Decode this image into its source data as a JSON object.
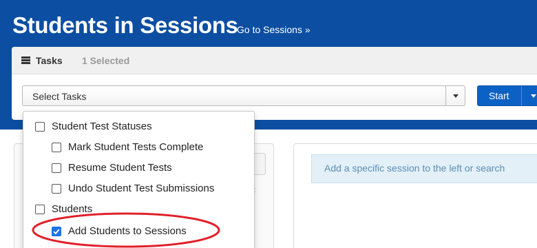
{
  "header": {
    "title": "Students in Sessions",
    "go_link": "Go to Sessions »"
  },
  "tasks": {
    "label": "Tasks",
    "selected_count": "1 Selected",
    "select_placeholder": "Select Tasks",
    "start_label": "Start",
    "menu": [
      {
        "label": "Student Test Statuses",
        "checked": false,
        "level": 0
      },
      {
        "label": "Mark Student Tests Complete",
        "checked": false,
        "level": 1
      },
      {
        "label": "Resume Student Tests",
        "checked": false,
        "level": 1
      },
      {
        "label": "Undo Student Test Submissions",
        "checked": false,
        "level": 1
      },
      {
        "label": "Students",
        "checked": false,
        "level": 0
      },
      {
        "label": "Add Students to Sessions",
        "checked": true,
        "level": 1
      }
    ]
  },
  "right_panel": {
    "info_text": "Add a specific session to the left or search"
  },
  "left_panel": {
    "obscured_marker": "x"
  },
  "colors": {
    "brand_blue": "#0b4ea2",
    "start_button": "#0b61c4",
    "highlight_red": "#e0202a",
    "info_bg": "#e4f0f8"
  },
  "icons": {
    "tasks": "list-icon",
    "dropdown_caret": "caret-down-icon",
    "checkbox": "checkbox-icon"
  }
}
